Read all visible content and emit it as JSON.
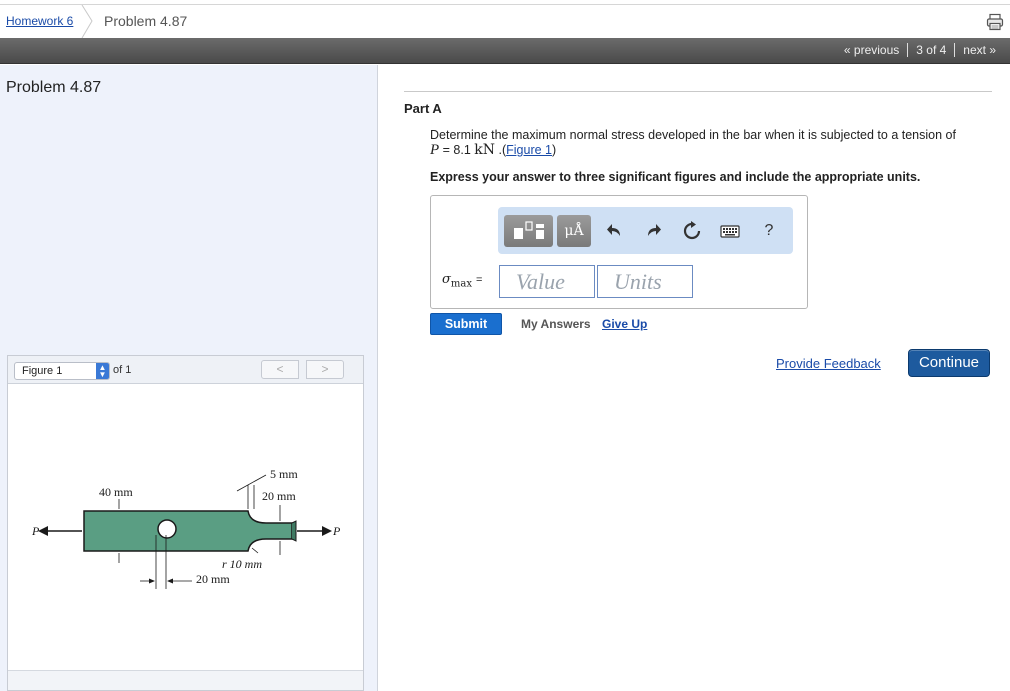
{
  "breadcrumb": {
    "assignment_link": "Homework 6",
    "current": "Problem 4.87"
  },
  "nav": {
    "previous": "« previous",
    "position": "3 of 4",
    "next": "next »"
  },
  "problem": {
    "title": "Problem 4.87"
  },
  "figure_panel": {
    "selected": "Figure 1",
    "of_label": "of 1",
    "prev": "<",
    "next": ">",
    "labels": {
      "d40": "40 mm",
      "d5": "5 mm",
      "d20top": "20 mm",
      "r10": "r  10 mm",
      "d20bot": "20 mm",
      "p_left": "P",
      "p_right": "P"
    },
    "colors": {
      "bar": "#5a9e83",
      "outline": "#1a1a1a"
    }
  },
  "part": {
    "label": "Part A",
    "question_prefix": "Determine the maximum normal stress developed in the bar when it is subjected to a tension of",
    "p_var": "P",
    "p_value": " = 8.1 ",
    "p_unit": "kN",
    "link_prefix": " .(",
    "figure_link": "Figure 1",
    "link_suffix": ")",
    "instruction": "Express your answer to three significant figures and include the appropriate units."
  },
  "answer": {
    "variable": "σ",
    "subscript": "max",
    "equals": "=",
    "value_placeholder": "Value",
    "units_placeholder": "Units",
    "toolbar": {
      "units_symbol": "μÅ",
      "help": "?",
      "icons": [
        "templates-icon",
        "units-icon",
        "undo-icon",
        "redo-icon",
        "reset-icon",
        "keyboard-icon",
        "help-icon"
      ]
    }
  },
  "actions": {
    "submit": "Submit",
    "my_answers": "My Answers",
    "give_up": "Give Up",
    "provide_feedback": "Provide Feedback",
    "continue": "Continue"
  },
  "colors": {
    "link": "#1a4ba8",
    "submit": "#1a6fcf",
    "continue": "#1d5a9e",
    "toolbar_bg": "#cfe0f4",
    "left_panel_bg": "#eef2fb"
  }
}
